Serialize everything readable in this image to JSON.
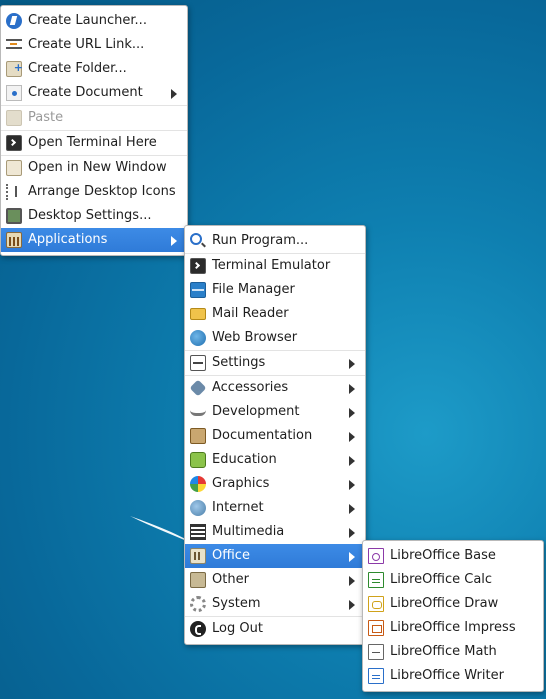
{
  "colors": {
    "desktop": "#0e7fb0",
    "highlight": "#3584e4",
    "menu_bg": "#ffffff",
    "disabled_text": "#9a9a9a"
  },
  "desktop_menu": {
    "items": [
      {
        "label": "Create Launcher...",
        "icon": "launcher-icon"
      },
      {
        "label": "Create URL Link...",
        "icon": "url-link-icon"
      },
      {
        "label": "Create Folder...",
        "icon": "new-folder-icon"
      },
      {
        "label": "Create Document",
        "icon": "new-document-icon",
        "submenu": true
      },
      {
        "label": "Paste",
        "icon": "paste-icon",
        "disabled": true
      },
      {
        "label": "Open Terminal Here",
        "icon": "terminal-icon"
      },
      {
        "label": "Open in New Window",
        "icon": "window-icon"
      },
      {
        "label": "Arrange Desktop Icons",
        "icon": "arrange-icon"
      },
      {
        "label": "Desktop Settings...",
        "icon": "desktop-settings-icon"
      },
      {
        "label": "Applications",
        "icon": "applications-icon",
        "submenu": true,
        "active": true
      }
    ]
  },
  "applications_menu": {
    "items": [
      {
        "label": "Run Program...",
        "icon": "run-program-icon"
      },
      {
        "label": "Terminal Emulator",
        "icon": "terminal-icon"
      },
      {
        "label": "File Manager",
        "icon": "file-manager-icon"
      },
      {
        "label": "Mail Reader",
        "icon": "mail-icon"
      },
      {
        "label": "Web Browser",
        "icon": "web-browser-icon"
      },
      {
        "label": "Settings",
        "icon": "settings-icon",
        "submenu": true
      },
      {
        "label": "Accessories",
        "icon": "accessories-icon",
        "submenu": true
      },
      {
        "label": "Development",
        "icon": "development-icon",
        "submenu": true
      },
      {
        "label": "Documentation",
        "icon": "documentation-icon",
        "submenu": true
      },
      {
        "label": "Education",
        "icon": "education-icon",
        "submenu": true
      },
      {
        "label": "Graphics",
        "icon": "graphics-icon",
        "submenu": true
      },
      {
        "label": "Internet",
        "icon": "internet-icon",
        "submenu": true
      },
      {
        "label": "Multimedia",
        "icon": "multimedia-icon",
        "submenu": true
      },
      {
        "label": "Office",
        "icon": "office-icon",
        "submenu": true,
        "active": true
      },
      {
        "label": "Other",
        "icon": "other-icon",
        "submenu": true
      },
      {
        "label": "System",
        "icon": "system-icon",
        "submenu": true
      },
      {
        "label": "Log Out",
        "icon": "log-out-icon"
      }
    ]
  },
  "office_menu": {
    "items": [
      {
        "label": "LibreOffice Base",
        "icon": "libreoffice-base-icon"
      },
      {
        "label": "LibreOffice Calc",
        "icon": "libreoffice-calc-icon"
      },
      {
        "label": "LibreOffice Draw",
        "icon": "libreoffice-draw-icon"
      },
      {
        "label": "LibreOffice Impress",
        "icon": "libreoffice-impress-icon"
      },
      {
        "label": "LibreOffice Math",
        "icon": "libreoffice-math-icon"
      },
      {
        "label": "LibreOffice Writer",
        "icon": "libreoffice-writer-icon"
      }
    ]
  }
}
